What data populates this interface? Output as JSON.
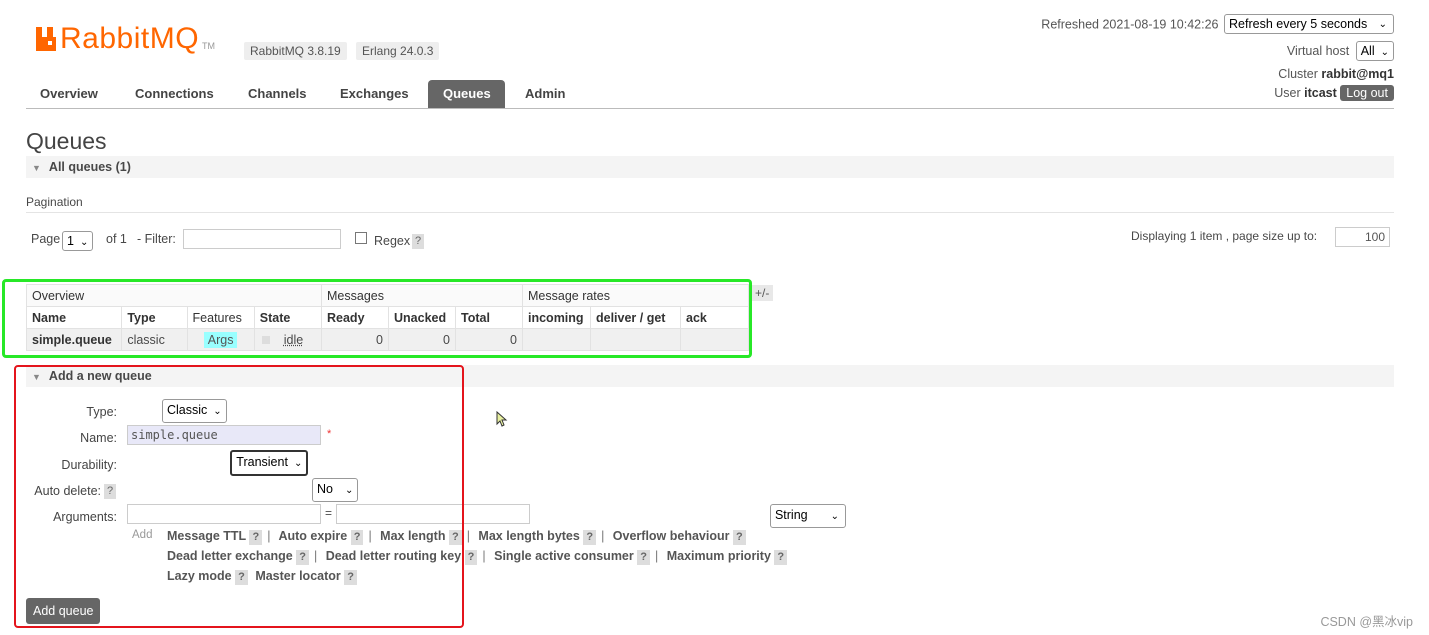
{
  "header": {
    "logo": "RabbitMQ",
    "logo_tm": "TM",
    "version": "RabbitMQ 3.8.19",
    "erlang": "Erlang 24.0.3",
    "refreshed": "Refreshed 2021-08-19 10:42:26",
    "refresh_select": "Refresh every 5 seconds",
    "virtual_host_label": "Virtual host",
    "virtual_host_value": "All",
    "cluster_label": "Cluster",
    "cluster_value": "rabbit@mq1",
    "user_label": "User",
    "user_value": "itcast",
    "logout": "Log out"
  },
  "tabs": [
    {
      "label": "Overview",
      "active": false
    },
    {
      "label": "Connections",
      "active": false
    },
    {
      "label": "Channels",
      "active": false
    },
    {
      "label": "Exchanges",
      "active": false
    },
    {
      "label": "Queues",
      "active": true
    },
    {
      "label": "Admin",
      "active": false
    }
  ],
  "page_title": "Queues",
  "all_queues": "All queues (1)",
  "pagination": {
    "label": "Pagination",
    "page_label": "Page",
    "page_value": "1",
    "of": "of 1",
    "filter_label": "- Filter:",
    "regex_label": "Regex",
    "help": "?",
    "displaying": "Displaying 1 item , page size up to:",
    "page_size": "100"
  },
  "table": {
    "groups": [
      "Overview",
      "Messages",
      "Message rates"
    ],
    "headers": [
      "Name",
      "Type",
      "Features",
      "State",
      "Ready",
      "Unacked",
      "Total",
      "incoming",
      "deliver / get",
      "ack"
    ],
    "row": {
      "name": "simple.queue",
      "type": "classic",
      "features": "Args",
      "state": "idle",
      "ready": "0",
      "unacked": "0",
      "total": "0",
      "incoming": "",
      "deliver_get": "",
      "ack": ""
    },
    "plus_minus": "+/-"
  },
  "add_queue": {
    "section": "Add a new queue",
    "type_label": "Type:",
    "type_value": "Classic",
    "name_label": "Name:",
    "name_value": "simple.queue",
    "required": "*",
    "durability_label": "Durability:",
    "durability_value": "Transient",
    "auto_delete_label": "Auto delete:",
    "auto_delete_help": "?",
    "auto_delete_value": "No",
    "arguments_label": "Arguments:",
    "equals": "=",
    "arg_type_value": "String",
    "add_label": "Add",
    "arg_links_row1": [
      "Message TTL",
      "Auto expire",
      "Max length",
      "Max length bytes",
      "Overflow behaviour"
    ],
    "arg_links_row2": [
      "Dead letter exchange",
      "Dead letter routing key",
      "Single active consumer",
      "Maximum priority"
    ],
    "arg_links_row3": [
      "Lazy mode",
      "Master locator"
    ],
    "submit": "Add queue"
  },
  "watermark": "CSDN @黑冰vip",
  "colors": {
    "brand": "#ff6600",
    "green_box": "#27e827",
    "red_box": "#e4141c",
    "tab_active": "#666666"
  }
}
